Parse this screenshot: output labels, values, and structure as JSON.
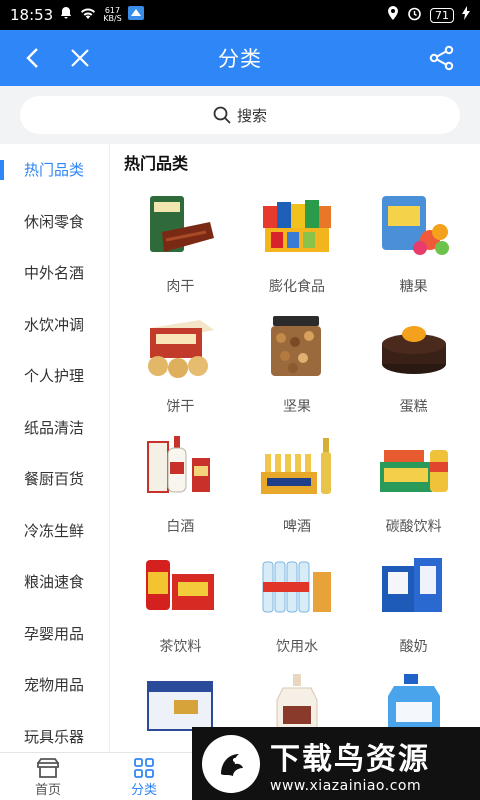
{
  "status": {
    "time": "18:53",
    "net_speed_value": "617",
    "net_speed_unit": "KB/S",
    "battery": "71"
  },
  "header": {
    "title": "分类"
  },
  "search": {
    "placeholder": "搜索"
  },
  "sidebar": {
    "items": [
      {
        "label": "热门品类",
        "active": true
      },
      {
        "label": "休闲零食"
      },
      {
        "label": "中外名酒"
      },
      {
        "label": "水饮冲调"
      },
      {
        "label": "个人护理"
      },
      {
        "label": "纸品清洁"
      },
      {
        "label": "餐厨百货"
      },
      {
        "label": "冷冻生鲜"
      },
      {
        "label": "粮油速食"
      },
      {
        "label": "孕婴用品"
      },
      {
        "label": "宠物用品"
      },
      {
        "label": "玩具乐器"
      }
    ]
  },
  "main": {
    "section_title": "热门品类",
    "products": [
      {
        "label": "肉干",
        "icon": "jerky-pack-icon"
      },
      {
        "label": "膨化食品",
        "icon": "snack-bags-icon"
      },
      {
        "label": "糖果",
        "icon": "candy-bag-icon"
      },
      {
        "label": "饼干",
        "icon": "biscuit-box-icon"
      },
      {
        "label": "坚果",
        "icon": "nut-jar-icon"
      },
      {
        "label": "蛋糕",
        "icon": "cake-icon"
      },
      {
        "label": "白酒",
        "icon": "baijiu-bottle-icon"
      },
      {
        "label": "啤酒",
        "icon": "beer-case-icon"
      },
      {
        "label": "碳酸饮料",
        "icon": "soda-can-icon"
      },
      {
        "label": "茶饮料",
        "icon": "tea-can-icon"
      },
      {
        "label": "饮用水",
        "icon": "water-bottles-icon"
      },
      {
        "label": "酸奶",
        "icon": "yogurt-box-icon"
      },
      {
        "label": "",
        "icon": "milk-box-icon"
      },
      {
        "label": "",
        "icon": "shampoo-bottle-icon"
      },
      {
        "label": "",
        "icon": "detergent-bottle-icon"
      }
    ]
  },
  "tabbar": {
    "tabs": [
      {
        "label": "首页"
      },
      {
        "label": "分类",
        "active": true
      }
    ]
  },
  "watermark": {
    "text": "下载鸟资源",
    "url": "www.xiazainiao.com"
  },
  "colors": {
    "accent": "#2f86f6"
  }
}
